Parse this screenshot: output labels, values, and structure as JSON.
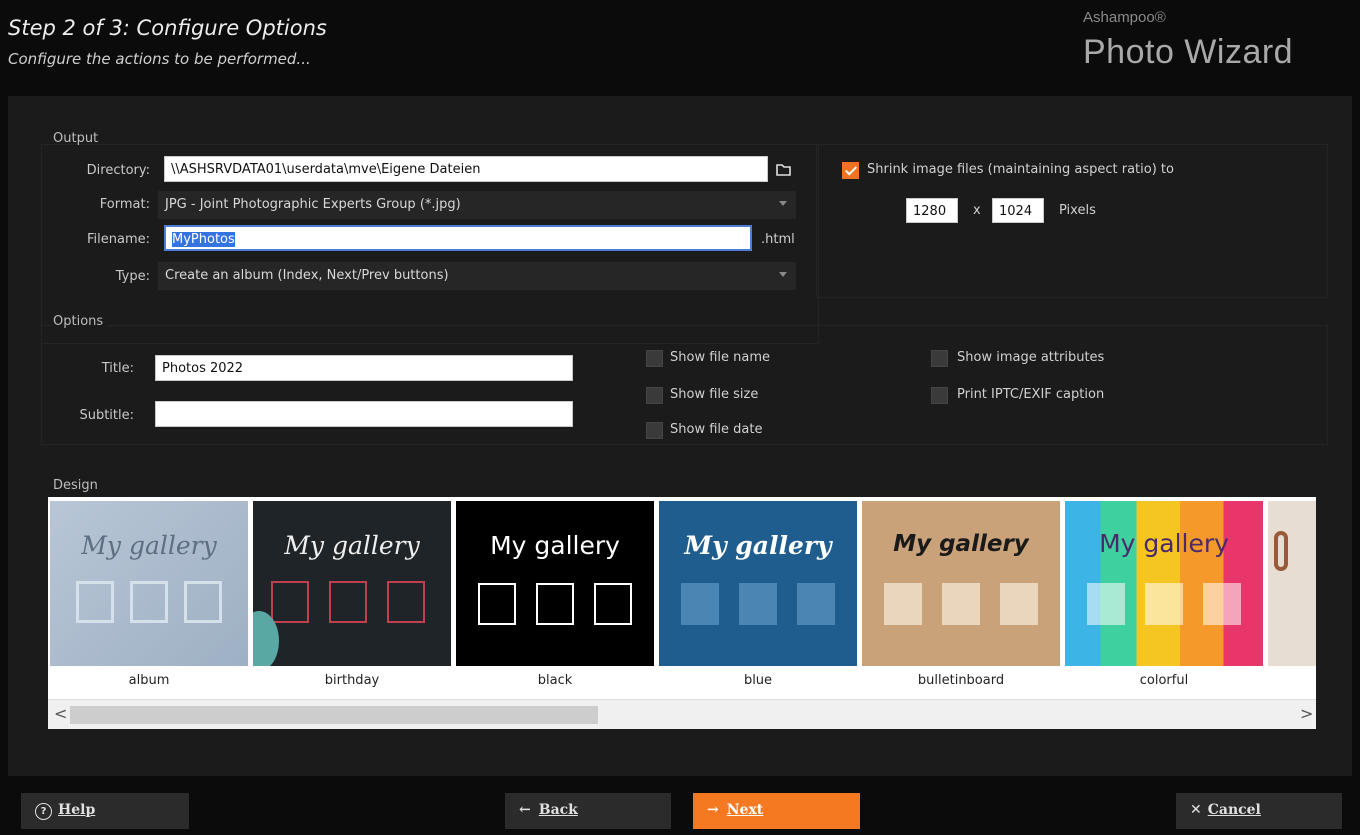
{
  "header": {
    "step_title": "Step 2 of 3: Configure Options",
    "step_subtitle": "Configure the actions to be performed...",
    "brand_small": "Ashampoo®",
    "brand_big": "Photo Wizard"
  },
  "output": {
    "section_label": "Output",
    "directory_label": "Directory:",
    "directory_value": "\\\\ASHSRVDATA01\\userdata\\mve\\Eigene Dateien",
    "format_label": "Format:",
    "format_value": "JPG - Joint Photographic Experts Group (*.jpg)",
    "filename_label": "Filename:",
    "filename_value": "MyPhotos",
    "filename_ext": ".html",
    "type_label": "Type:",
    "type_value": "Create an album (Index, Next/Prev buttons)",
    "shrink_checked": true,
    "shrink_label": "Shrink image files (maintaining aspect ratio) to",
    "width_value": "1280",
    "x_label": "x",
    "height_value": "1024",
    "pixels_label": "Pixels"
  },
  "options": {
    "section_label": "Options",
    "title_label": "Title:",
    "title_value": "Photos 2022",
    "subtitle_label": "Subtitle:",
    "subtitle_value": "",
    "checks": {
      "show_file_name": "Show file name",
      "show_file_size": "Show file size",
      "show_file_date": "Show file date",
      "show_image_attributes": "Show image attributes",
      "print_caption": "Print IPTC/EXIF caption"
    }
  },
  "design": {
    "section_label": "Design",
    "gallery_text": "My gallery",
    "thumbs": [
      {
        "name": "album"
      },
      {
        "name": "birthday"
      },
      {
        "name": "black"
      },
      {
        "name": "blue"
      },
      {
        "name": "bulletinboard"
      },
      {
        "name": "colorful"
      }
    ],
    "scroll_left": "<",
    "scroll_right": ">"
  },
  "footer": {
    "help_label": "Help",
    "back_label": "Back",
    "next_label": "Next",
    "cancel_label": "Cancel"
  },
  "colors": {
    "accent": "#f57921",
    "background": "#0b0b0b",
    "panel": "#1b1b1b"
  }
}
